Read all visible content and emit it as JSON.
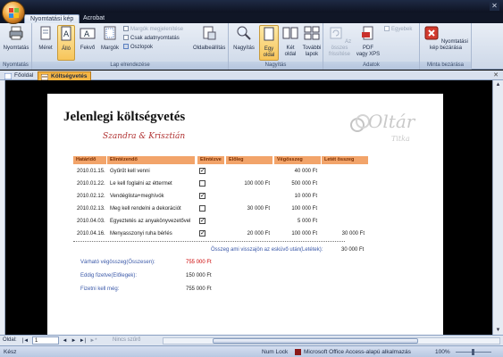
{
  "window": {
    "close_glyph": "✕"
  },
  "ribbon_tabs": [
    {
      "label": "Nyomtatási kép",
      "active": true
    },
    {
      "label": "Acrobat",
      "active": false
    }
  ],
  "ribbon": {
    "groups": {
      "print": "Nyomtatás",
      "page_layout": "Lap elrendezése",
      "zoom": "Nagyítás",
      "data": "Adatok",
      "close": "Minta bezárása"
    },
    "print_btn": "Nyomtatás",
    "size_btn": "Méret",
    "portrait_btn": "Álló",
    "landscape_btn": "Fekvő",
    "margins_btn": "Margók",
    "show_margins": "Margók megjelenítése",
    "data_only": "Csak adatnyomtatás",
    "columns": "Oszlopok",
    "page_setup": "Oldalbeállítás",
    "zoom_btn": "Nagyítás",
    "one_page_l1": "Egy",
    "one_page_l2": "oldal",
    "two_pages_l1": "Két",
    "two_pages_l2": "oldal",
    "more_pages_l1": "További",
    "more_pages_l2": "lapok",
    "refresh_l1": "Az összes",
    "refresh_l2": "frissítése",
    "pdf_l1": "PDF",
    "pdf_l2": "vagy XPS",
    "more_btn": "Egyebek",
    "close_l1": "Nyomtatási",
    "close_l2": "kép bezárása"
  },
  "doc_tabs": [
    {
      "label": "Főoldal",
      "active": false
    },
    {
      "label": "Költségvetés",
      "active": true
    }
  ],
  "report": {
    "title": "Jelenlegi költségvetés",
    "subtitle": "Szandra & Krisztián",
    "logo_text": "Oltár",
    "logo_sub": "Titka",
    "headers": [
      "Határidő",
      "Elintézendő",
      "Elintézve",
      "Előleg",
      "Végösszeg",
      "Letét összeg"
    ],
    "rows": [
      {
        "date": "2010.01.15.",
        "task": "Gyűrűt kell venni",
        "done": true,
        "advance": "",
        "total": "40 000 Ft",
        "deposit": ""
      },
      {
        "date": "2010.01.22.",
        "task": "Le kell foglalni az éttermet",
        "done": false,
        "advance": "100 000 Ft",
        "total": "500 000 Ft",
        "deposit": ""
      },
      {
        "date": "2010.02.12.",
        "task": "Vendéglista+meghívók",
        "done": true,
        "advance": "",
        "total": "10 000 Ft",
        "deposit": ""
      },
      {
        "date": "2010.02.13.",
        "task": "Meg kell rendelni a dekorációt",
        "done": false,
        "advance": "30 000 Ft",
        "total": "100 000 Ft",
        "deposit": ""
      },
      {
        "date": "2010.04.03.",
        "task": "Egyeztetés az anyakönyvezetővel",
        "done": true,
        "advance": "",
        "total": "5 000 Ft",
        "deposit": ""
      },
      {
        "date": "2010.04.16.",
        "task": "Menyasszonyi ruha bérlés",
        "done": true,
        "advance": "20 000 Ft",
        "total": "100 000 Ft",
        "deposit": "30 000 Ft"
      }
    ],
    "deposit_sum_label": "Összeg ami visszajön az esküvő után(Letétek):",
    "deposit_sum_value": "30 000 Ft",
    "expected_label": "Várható végösszeg(Összesen):",
    "expected_value": "755 000 Ft",
    "paid_label": "Eddig fizetve(Előlegek):",
    "paid_value": "150 000 Ft",
    "to_pay_label": "Fizetni kell még:",
    "to_pay_value": "755 000 Ft"
  },
  "nav": {
    "label": "Oldal:",
    "page": "1",
    "first": "|◄",
    "prev": "◄",
    "next": "►",
    "last": "►|",
    "new": "►*",
    "filter": "Nincs szűrő"
  },
  "status": {
    "ready": "Kész",
    "numlock": "Num Lock",
    "app_name": "Microsoft Office Access-alapú alkalmazás",
    "zoom": "100%"
  },
  "colors": {
    "accent_orange": "#f2a46a",
    "subtitle_red": "#b03030",
    "label_blue": "#3a58a8",
    "value_red": "#cc0000"
  }
}
